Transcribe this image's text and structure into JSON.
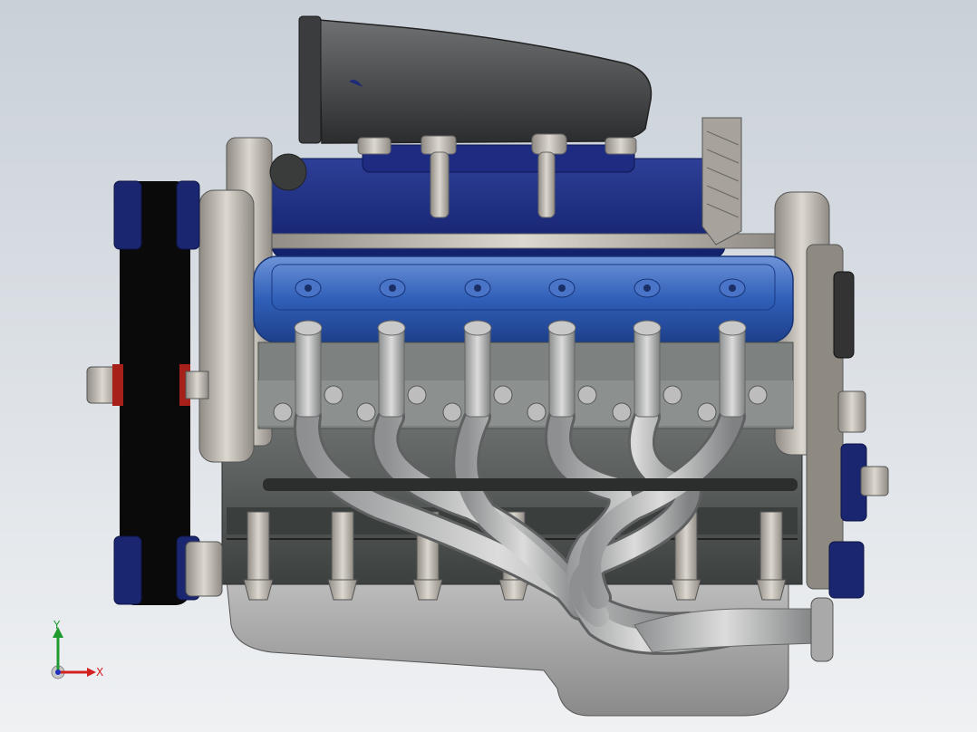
{
  "viewport": {
    "background_top": "#c9d0d8",
    "background_bottom": "#eff1f3"
  },
  "model": {
    "accent_blue": "#2f5fb8",
    "dark_blue": "#1a2b73",
    "metal": "#b9b5ad",
    "dark_metal": "#4e5250",
    "belt": "#0a0a0a",
    "red_accent": "#a8201a"
  },
  "triad": {
    "x_label": "X",
    "y_label": "Y",
    "x_color": "#d21f1f",
    "y_color": "#1e9a2f",
    "z_color": "#1e2fbf"
  }
}
